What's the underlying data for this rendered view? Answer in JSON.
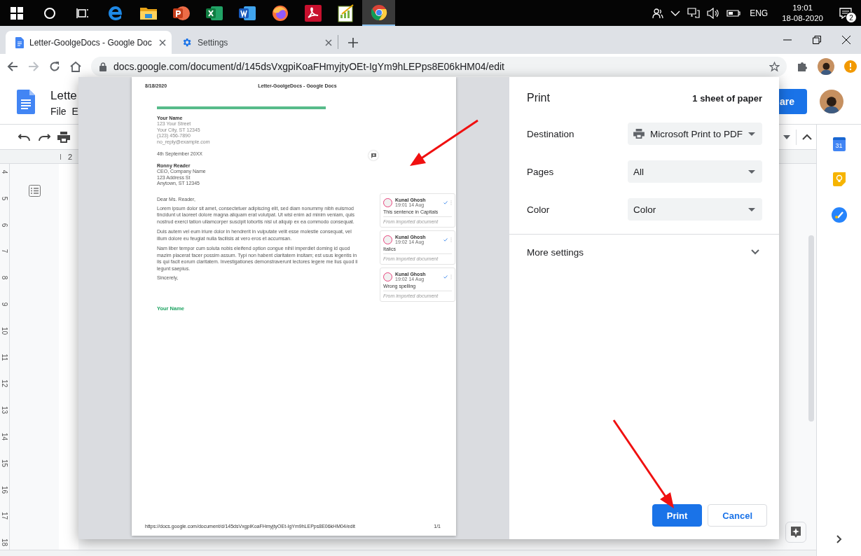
{
  "taskbar": {
    "apps": [
      {
        "kind": "start",
        "selected": false
      },
      {
        "kind": "search",
        "selected": false
      },
      {
        "kind": "task-view",
        "selected": false
      },
      {
        "kind": "edge",
        "selected": false
      },
      {
        "kind": "explorer",
        "selected": false
      },
      {
        "kind": "powerpoint",
        "selected": false
      },
      {
        "kind": "excel",
        "selected": false
      },
      {
        "kind": "word",
        "selected": false
      },
      {
        "kind": "firefox",
        "selected": false
      },
      {
        "kind": "acrobat",
        "selected": false
      },
      {
        "kind": "chart-app",
        "selected": false
      },
      {
        "kind": "chrome",
        "selected": true
      }
    ],
    "language": "ENG",
    "time": "19:01",
    "date": "18-08-2020",
    "notification_count": "2"
  },
  "browser": {
    "tabs": [
      {
        "title": "Letter-GoolgeDocs - Google Doc",
        "kind": "docs",
        "selected": true
      },
      {
        "title": "Settings",
        "kind": "settings",
        "selected": false
      }
    ],
    "url": "docs.google.com/document/d/145dsVxgpiKoaFHmyjtyOEt-IgYm9hLEPps8E06kHM04/edit"
  },
  "docs": {
    "title": "Lette",
    "menus": [
      "File",
      "E"
    ],
    "share_label": "are",
    "ruler_label": "2",
    "ruler_numbers": [
      "4",
      "5",
      "6",
      "7",
      "8",
      "9",
      "10",
      "11",
      "12",
      "13",
      "14",
      "15",
      "16",
      "17",
      "18"
    ],
    "calendar_day": "31"
  },
  "print_dialog": {
    "preview": {
      "header_date": "8/18/2020",
      "header_title": "Letter-GoolgeDocs - Google Docs",
      "sender": {
        "name": "Your Name",
        "lines": [
          "123 Your Street",
          "Your City, ST 12345",
          "(123) 456-7890",
          "no_reply@example.com"
        ]
      },
      "date_line": "4th September 20XX",
      "recipient": {
        "name": "Ronny Reader",
        "lines": [
          "CEO, Company Name",
          "123 Address St",
          "Anytown, ST 12345"
        ]
      },
      "salutation": "Dear Ms. Reader,",
      "paragraphs": [
        "Lorem ipsum dolor sit amet, consectetuer adipiscing elit, sed diam nonummy nibh euismod tincidunt ut laoreet dolore magna aliquam erat volutpat. Ut wisi enim ad minim veniam, quis nostrud exerci tation ullamcorper suscipit lobortis nisl ut aliquip ex ea commodo consequat.",
        "Duis autem vel eum iriure dolor in hendrerit in vulputate velit esse molestie consequat, vel illum dolore eu feugiat nulla facilisis at vero eros et accumsan.",
        "Nam liber tempor cum soluta nobis eleifend option congue nihil imperdiet doming id quod mazim placerat facer possim assum. Typi non habent claritatem insitam; est usus legentis in iis qui facit eorum claritatem. Investigationes demonstraverunt lectores legere me lius quod ii legunt saepius."
      ],
      "closing": "Sincerely,",
      "signature": "Your Name",
      "comments": [
        {
          "author": "Kunal Ghosh",
          "time": "19:01 14 Aug",
          "text": "This sentence in Capitals",
          "note": "From imported document"
        },
        {
          "author": "Kunal Ghosh",
          "time": "19:02 14 Aug",
          "text": "Italics",
          "note": "From imported document"
        },
        {
          "author": "Kunal Ghosh",
          "time": "19:02 14 Aug",
          "text": "Wrong spelling",
          "note": "From imported document"
        }
      ],
      "footer_url": "https://docs.google.com/document/d/145dsVxgpiKoaFHmyjtyOEt-IgYm9hLEPps8E06kHM04/edit",
      "page_number": "1/1"
    },
    "settings": {
      "title": "Print",
      "sheets": "1 sheet of paper",
      "fields": [
        {
          "label": "Destination",
          "value": "Microsoft Print to PDF",
          "kind": "printer"
        },
        {
          "label": "Pages",
          "value": "All",
          "kind": "dropdown"
        },
        {
          "label": "Color",
          "value": "Color",
          "kind": "dropdown"
        }
      ],
      "more_settings": "More settings",
      "expanded": false,
      "buttons": [
        {
          "label": "Print",
          "kind": "primary"
        },
        {
          "label": "Cancel",
          "kind": "secondary"
        }
      ]
    }
  }
}
